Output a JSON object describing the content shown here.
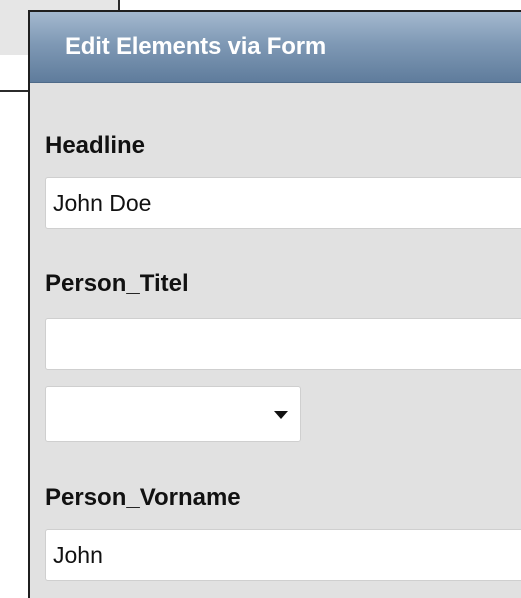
{
  "dialog": {
    "title": "Edit Elements via Form"
  },
  "fields": {
    "headline": {
      "label": "Headline",
      "value": "John Doe"
    },
    "person_titel": {
      "label": "Person_Titel",
      "value": "",
      "select_value": ""
    },
    "person_vorname": {
      "label": "Person_Vorname",
      "value": "John"
    }
  },
  "colors": {
    "header_gradient_top": "#a4b9cf",
    "header_gradient_bottom": "#5f7c9c",
    "dialog_background": "#e1e1e1"
  }
}
